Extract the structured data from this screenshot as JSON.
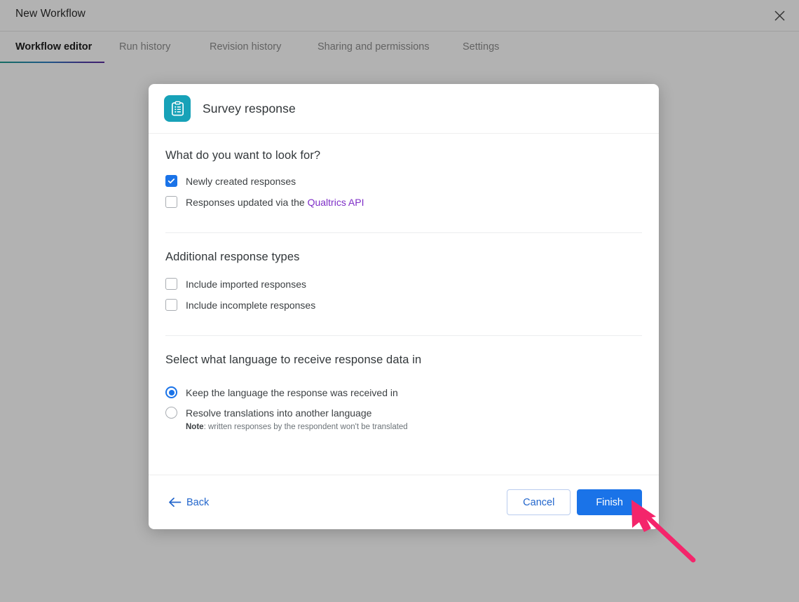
{
  "window": {
    "title": "New Workflow",
    "close_icon": "close-icon"
  },
  "tabs": [
    {
      "label": "Workflow editor",
      "active": true
    },
    {
      "label": "Run history",
      "active": false
    },
    {
      "label": "Revision history",
      "active": false
    },
    {
      "label": "Sharing and permissions",
      "active": false
    },
    {
      "label": "Settings",
      "active": false
    }
  ],
  "modal": {
    "icon": "clipboard-survey-icon",
    "title": "Survey response",
    "sections": [
      {
        "title": "What do you want to look for?",
        "options": [
          {
            "type": "checkbox",
            "checked": true,
            "label": "Newly created responses"
          },
          {
            "type": "checkbox",
            "checked": false,
            "label_before": "Responses updated via the",
            "link": "Qualtrics API"
          }
        ]
      },
      {
        "title": "Additional response types",
        "options": [
          {
            "type": "checkbox",
            "checked": false,
            "label": "Include imported responses"
          },
          {
            "type": "checkbox",
            "checked": false,
            "label": "Include incomplete responses"
          }
        ]
      },
      {
        "title": "Select what language to receive response data in",
        "options": [
          {
            "type": "radio",
            "checked": true,
            "label": "Keep the language the response was received in"
          },
          {
            "type": "radio",
            "checked": false,
            "label": "Resolve translations into another language",
            "note_bold": "Note",
            "note_text": ": written responses by the respondent won't be translated"
          }
        ]
      }
    ],
    "footer": {
      "back_label": "Back",
      "back_icon": "arrow-left-icon",
      "cancel_label": "Cancel",
      "finish_label": "Finish"
    }
  },
  "colors": {
    "accent_blue": "#1a73e8",
    "link_purple": "#7e2ec7",
    "icon_teal": "#17a2b8",
    "cursor_pink": "#f4256b",
    "tab_underline_start": "#1f9d8f",
    "tab_underline_end": "#5b2ea0"
  }
}
